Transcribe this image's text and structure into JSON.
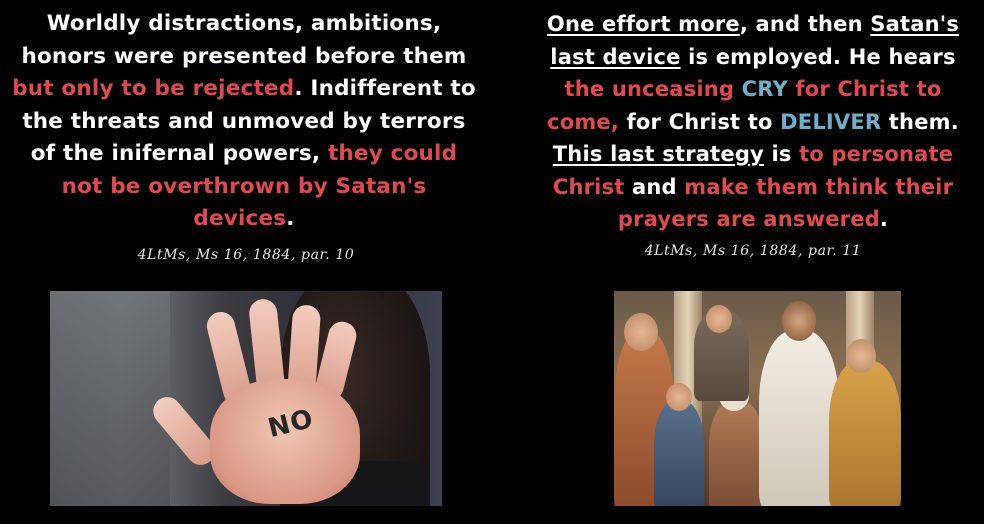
{
  "left": {
    "segments": [
      {
        "text": "Worldly distractions, ambitions, honors were presented before them ",
        "style": "white"
      },
      {
        "text": "but only to be rejected",
        "style": "red"
      },
      {
        "text": ". Indifferent to the threats and unmoved by terrors of the inifernal powers, ",
        "style": "white"
      },
      {
        "text": "they could not be overthrown by Satan's devices",
        "style": "red"
      },
      {
        "text": ".",
        "style": "white"
      }
    ],
    "citation": "4LtMs, Ms 16, 1884, par. 10",
    "image": {
      "word_on_hand": "NO"
    }
  },
  "right": {
    "segments": [
      {
        "text": "One effort more",
        "style": "underline"
      },
      {
        "text": ", and then ",
        "style": "white"
      },
      {
        "text": "Satan's last device",
        "style": "underline"
      },
      {
        "text": " is employed. He hears ",
        "style": "white"
      },
      {
        "text": "the unceasing ",
        "style": "red"
      },
      {
        "text": "CRY",
        "style": "blue"
      },
      {
        "text": " for Christ to come,",
        "style": "red"
      },
      {
        "text": " for Christ to ",
        "style": "white"
      },
      {
        "text": "DELIVER",
        "style": "blue"
      },
      {
        "text": " them. ",
        "style": "white"
      },
      {
        "text": "This last strategy",
        "style": "underline"
      },
      {
        "text": " is ",
        "style": "white"
      },
      {
        "text": "to personate Christ",
        "style": "red"
      },
      {
        "text": " and ",
        "style": "white"
      },
      {
        "text": "make them think their prayers are answered",
        "style": "red"
      },
      {
        "text": ".",
        "style": "white"
      }
    ],
    "citation": "4LtMs, Ms 16, 1884, par. 11"
  },
  "colors": {
    "red": "#e0494e",
    "blue": "#6fb0c8",
    "text": "#ffffff",
    "background": "#000000"
  }
}
